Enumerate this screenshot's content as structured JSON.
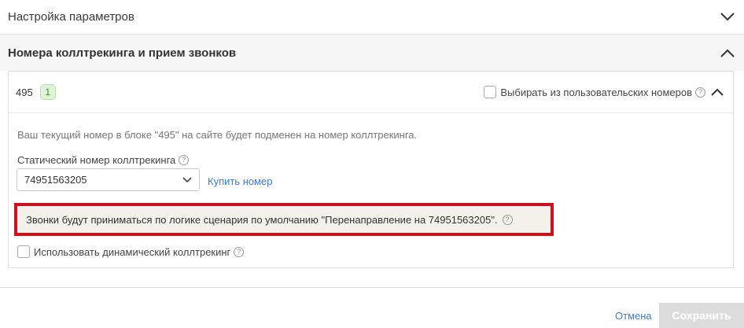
{
  "sections": {
    "settings": {
      "title": "Настройка параметров"
    },
    "calltracking": {
      "title": "Номера коллтрекинга и прием звонков"
    }
  },
  "block": {
    "name": "495",
    "count": "1",
    "choose_custom_label": "Выбирать из пользовательских номеров",
    "info_text": "Ваш текущий номер в блоке \"495\" на сайте будет подменен на номер коллтрекинга.",
    "static_number_label": "Статический номер коллтрекинга",
    "static_number_value": "74951563205",
    "buy_number_link": "Купить номер",
    "notice_text": "Звонки будут приниматься по логике сценария по умолчанию \"Перенаправление на 74951563205\".",
    "dynamic_label": "Использовать динамический коллтрекинг"
  },
  "footer": {
    "cancel_label": "Отмена",
    "save_label": "Сохранить"
  },
  "icons": {
    "help": "?"
  },
  "colors": {
    "link": "#3d7ec7",
    "notice_border": "#c8121d",
    "badge_bg": "#dff3d8",
    "badge_text": "#3b8a2a"
  }
}
